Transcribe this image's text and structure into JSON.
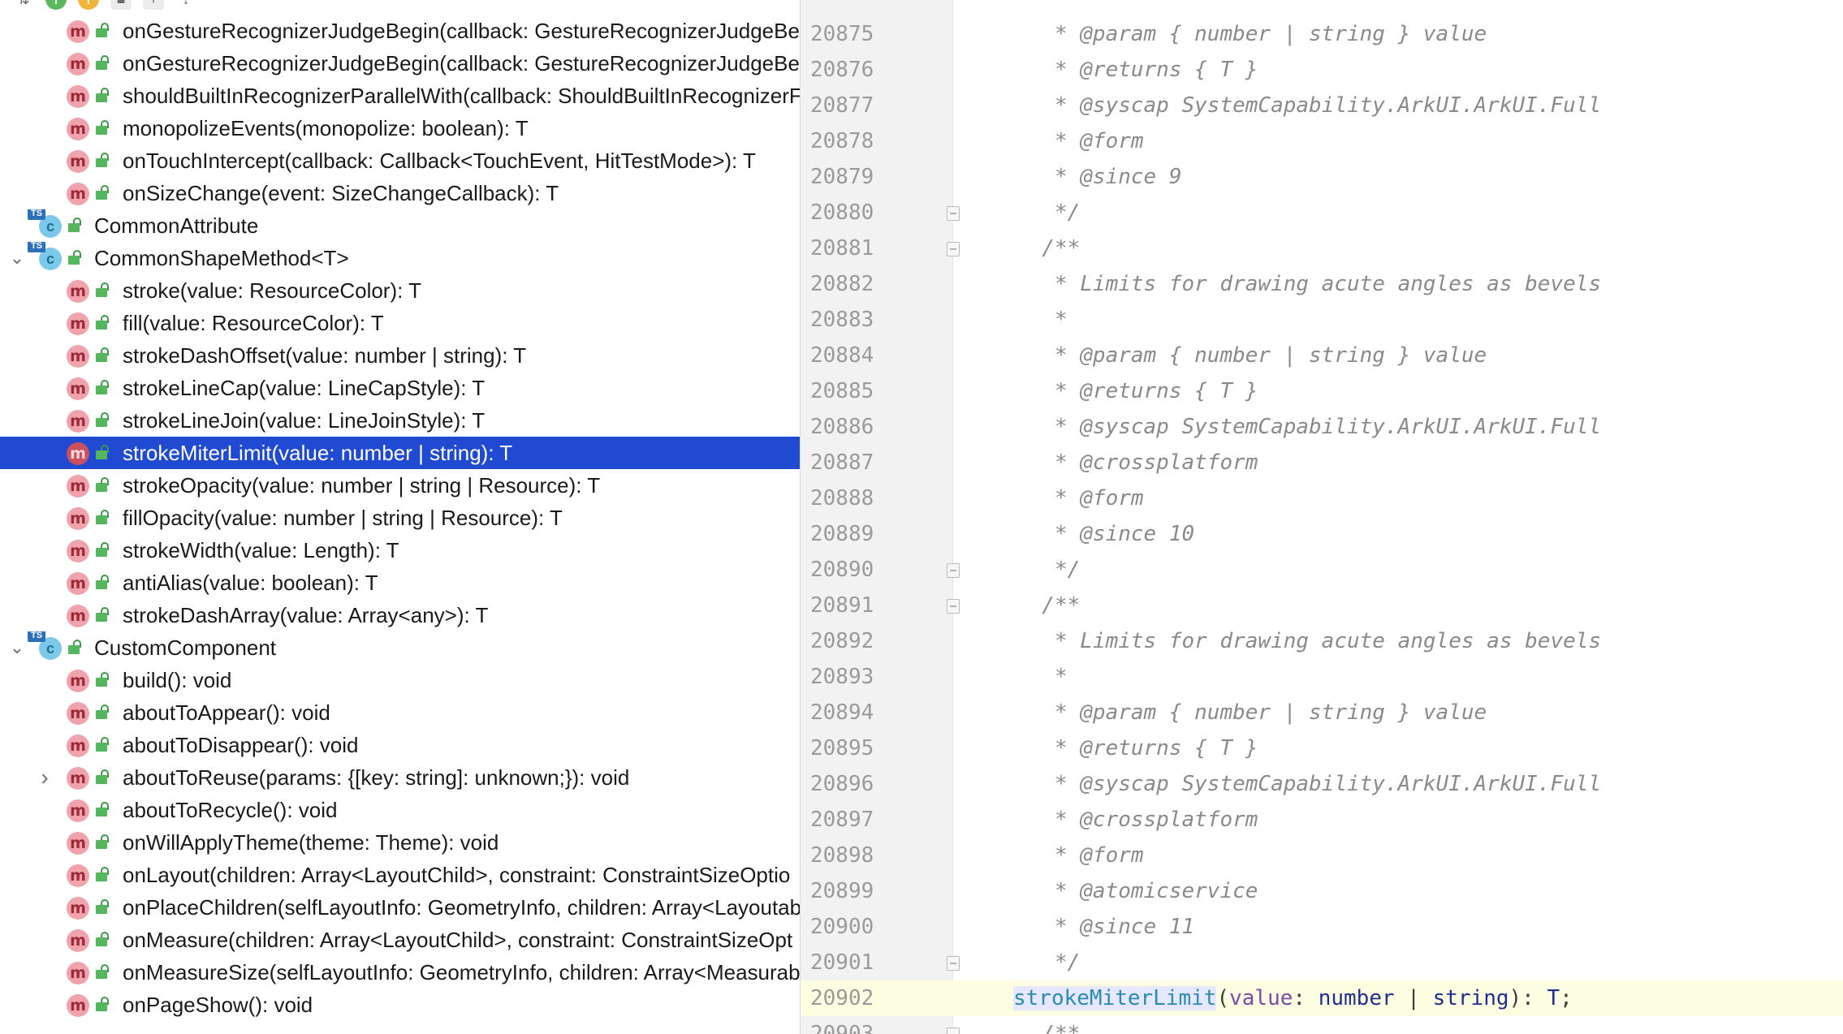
{
  "toolbar": {
    "icons": [
      "sort-icon",
      "green-badge-icon",
      "orange-badge-icon",
      "stop-icon",
      "plus-icon",
      "arrow-down-icon"
    ]
  },
  "tree": {
    "rows": [
      {
        "kind": "method",
        "indent": 1,
        "label": "onGestureRecognizerJudgeBegin(callback: GestureRecognizerJudgeBe"
      },
      {
        "kind": "method",
        "indent": 1,
        "label": "onGestureRecognizerJudgeBegin(callback: GestureRecognizerJudgeBe"
      },
      {
        "kind": "method",
        "indent": 1,
        "label": "shouldBuiltInRecognizerParallelWith(callback: ShouldBuiltInRecognizerF"
      },
      {
        "kind": "method",
        "indent": 1,
        "label": "monopolizeEvents(monopolize: boolean): T"
      },
      {
        "kind": "method",
        "indent": 1,
        "label": "onTouchIntercept(callback: Callback<TouchEvent, HitTestMode>): T"
      },
      {
        "kind": "method",
        "indent": 1,
        "label": "onSizeChange(event: SizeChangeCallback): T"
      },
      {
        "kind": "class",
        "indent": 0,
        "expander": "",
        "label": "CommonAttribute"
      },
      {
        "kind": "class",
        "indent": 0,
        "expander": "open",
        "label": "CommonShapeMethod<T>"
      },
      {
        "kind": "method",
        "indent": 1,
        "label": "stroke(value: ResourceColor): T"
      },
      {
        "kind": "method",
        "indent": 1,
        "label": "fill(value: ResourceColor): T"
      },
      {
        "kind": "method",
        "indent": 1,
        "label": "strokeDashOffset(value: number | string): T"
      },
      {
        "kind": "method",
        "indent": 1,
        "label": "strokeLineCap(value: LineCapStyle): T"
      },
      {
        "kind": "method",
        "indent": 1,
        "label": "strokeLineJoin(value: LineJoinStyle): T"
      },
      {
        "kind": "method",
        "indent": 1,
        "selected": true,
        "label": "strokeMiterLimit(value: number | string): T"
      },
      {
        "kind": "method",
        "indent": 1,
        "label": "strokeOpacity(value: number | string | Resource): T"
      },
      {
        "kind": "method",
        "indent": 1,
        "label": "fillOpacity(value: number | string | Resource): T"
      },
      {
        "kind": "method",
        "indent": 1,
        "label": "strokeWidth(value: Length): T"
      },
      {
        "kind": "method",
        "indent": 1,
        "label": "antiAlias(value: boolean): T"
      },
      {
        "kind": "method",
        "indent": 1,
        "label": "strokeDashArray(value: Array<any>): T"
      },
      {
        "kind": "class",
        "indent": 0,
        "expander": "open",
        "label": "CustomComponent"
      },
      {
        "kind": "method",
        "indent": 1,
        "label": "build(): void"
      },
      {
        "kind": "method",
        "indent": 1,
        "label": "aboutToAppear(): void"
      },
      {
        "kind": "method",
        "indent": 1,
        "label": "aboutToDisappear(): void"
      },
      {
        "kind": "method",
        "indent": 1,
        "expander": "closed",
        "label": "aboutToReuse(params: {[key: string]: unknown;}): void"
      },
      {
        "kind": "method",
        "indent": 1,
        "label": "aboutToRecycle(): void"
      },
      {
        "kind": "method",
        "indent": 1,
        "label": "onWillApplyTheme(theme: Theme): void"
      },
      {
        "kind": "method",
        "indent": 1,
        "label": "onLayout(children: Array<LayoutChild>, constraint: ConstraintSizeOptio"
      },
      {
        "kind": "method",
        "indent": 1,
        "label": "onPlaceChildren(selfLayoutInfo: GeometryInfo, children: Array<Layoutab"
      },
      {
        "kind": "method",
        "indent": 1,
        "label": "onMeasure(children: Array<LayoutChild>, constraint: ConstraintSizeOpt"
      },
      {
        "kind": "method",
        "indent": 1,
        "label": "onMeasureSize(selfLayoutInfo: GeometryInfo, children: Array<Measurab"
      },
      {
        "kind": "method",
        "indent": 1,
        "label": "onPageShow(): void"
      }
    ]
  },
  "editor": {
    "lines": [
      {
        "n": "20875",
        "text": "   * @param { number | string } value"
      },
      {
        "n": "20876",
        "text": "   * @returns { T }"
      },
      {
        "n": "20877",
        "text": "   * @syscap SystemCapability.ArkUI.ArkUI.Full"
      },
      {
        "n": "20878",
        "text": "   * @form"
      },
      {
        "n": "20879",
        "text": "   * @since 9"
      },
      {
        "n": "20880",
        "text": "   */",
        "fold": true
      },
      {
        "n": "20881",
        "text": "  /**",
        "fold": true
      },
      {
        "n": "20882",
        "text": "   * Limits for drawing acute angles as bevels"
      },
      {
        "n": "20883",
        "text": "   *"
      },
      {
        "n": "20884",
        "text": "   * @param { number | string } value"
      },
      {
        "n": "20885",
        "text": "   * @returns { T }"
      },
      {
        "n": "20886",
        "text": "   * @syscap SystemCapability.ArkUI.ArkUI.Full"
      },
      {
        "n": "20887",
        "text": "   * @crossplatform"
      },
      {
        "n": "20888",
        "text": "   * @form"
      },
      {
        "n": "20889",
        "text": "   * @since 10"
      },
      {
        "n": "20890",
        "text": "   */",
        "fold": true
      },
      {
        "n": "20891",
        "text": "  /**",
        "fold": true
      },
      {
        "n": "20892",
        "text": "   * Limits for drawing acute angles as bevels"
      },
      {
        "n": "20893",
        "text": "   *"
      },
      {
        "n": "20894",
        "text": "   * @param { number | string } value"
      },
      {
        "n": "20895",
        "text": "   * @returns { T }"
      },
      {
        "n": "20896",
        "text": "   * @syscap SystemCapability.ArkUI.ArkUI.Full"
      },
      {
        "n": "20897",
        "text": "   * @crossplatform"
      },
      {
        "n": "20898",
        "text": "   * @form"
      },
      {
        "n": "20899",
        "text": "   * @atomicservice"
      },
      {
        "n": "20900",
        "text": "   * @since 11"
      },
      {
        "n": "20901",
        "text": "   */",
        "fold": true
      },
      {
        "n": "20902",
        "current": true,
        "code": {
          "name": "strokeMiterLimit",
          "p1": "(",
          "param": "value",
          "colon1": ": ",
          "t1": "number",
          "bar": " | ",
          "t2": "string",
          "p2": ")",
          "colon2": ": ",
          "ret": "T",
          "semi": ";"
        }
      },
      {
        "n": "20903",
        "text": "  /**",
        "fold": true
      }
    ]
  },
  "colors": {
    "selection": "#1f4ad1",
    "method_icon": "#f1a3ac",
    "class_icon": "#7cc8e8",
    "current_line": "#fdfde2",
    "gutter": "#f2f2f2"
  }
}
